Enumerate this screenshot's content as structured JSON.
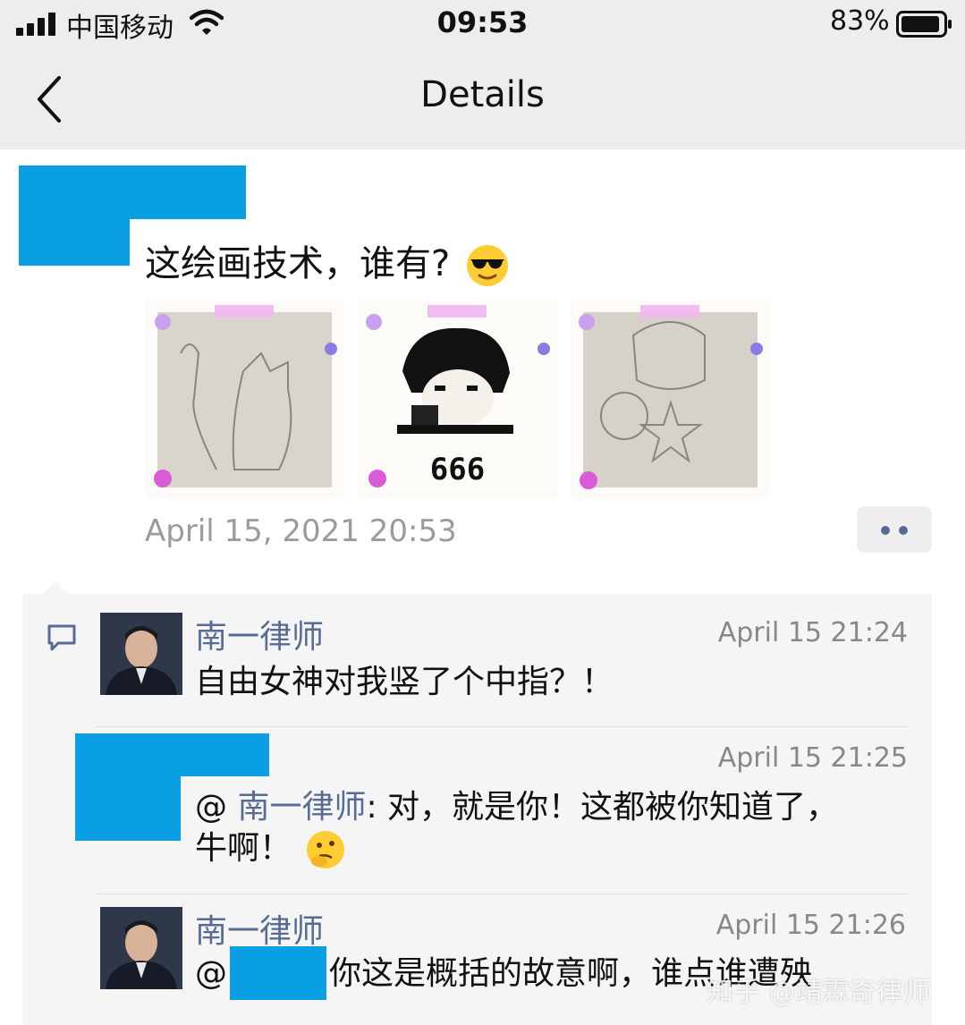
{
  "status_bar": {
    "carrier": "中国移动",
    "time": "09:53",
    "battery": "83%"
  },
  "nav": {
    "title": "Details",
    "back_icon": "chevron-left-icon"
  },
  "post": {
    "text": "这绘画技术，谁有?",
    "emoji": "sunglasses-emoji",
    "images": [
      {
        "name": "statue-of-liberty-drawing"
      },
      {
        "name": "meme-666",
        "caption": "666"
      },
      {
        "name": "captain-america-drawing"
      }
    ],
    "date": "April 15, 2021 20:53",
    "more_icon": "more-dots-icon"
  },
  "comments": [
    {
      "author": "南一律师",
      "time": "April 15 21:24",
      "text": "自由女神对我竖了个中指？！"
    },
    {
      "author": "",
      "time": "April 15 21:25",
      "mention": "南一律师",
      "line1": ": 对，就是你！这都被你知道了，",
      "line2": "牛啊！"
    },
    {
      "author": "南一律师",
      "time": "April 15 21:26",
      "at": "@",
      "text": "你这是概括的故意啊，谁点谁遭殃"
    }
  ],
  "watermark": "知乎 @靖霖奇律师",
  "colors": {
    "link": "#576b95",
    "redaction": "#0a9ee3",
    "comment_bg": "#f5f5f5",
    "header_bg": "#ededed"
  }
}
